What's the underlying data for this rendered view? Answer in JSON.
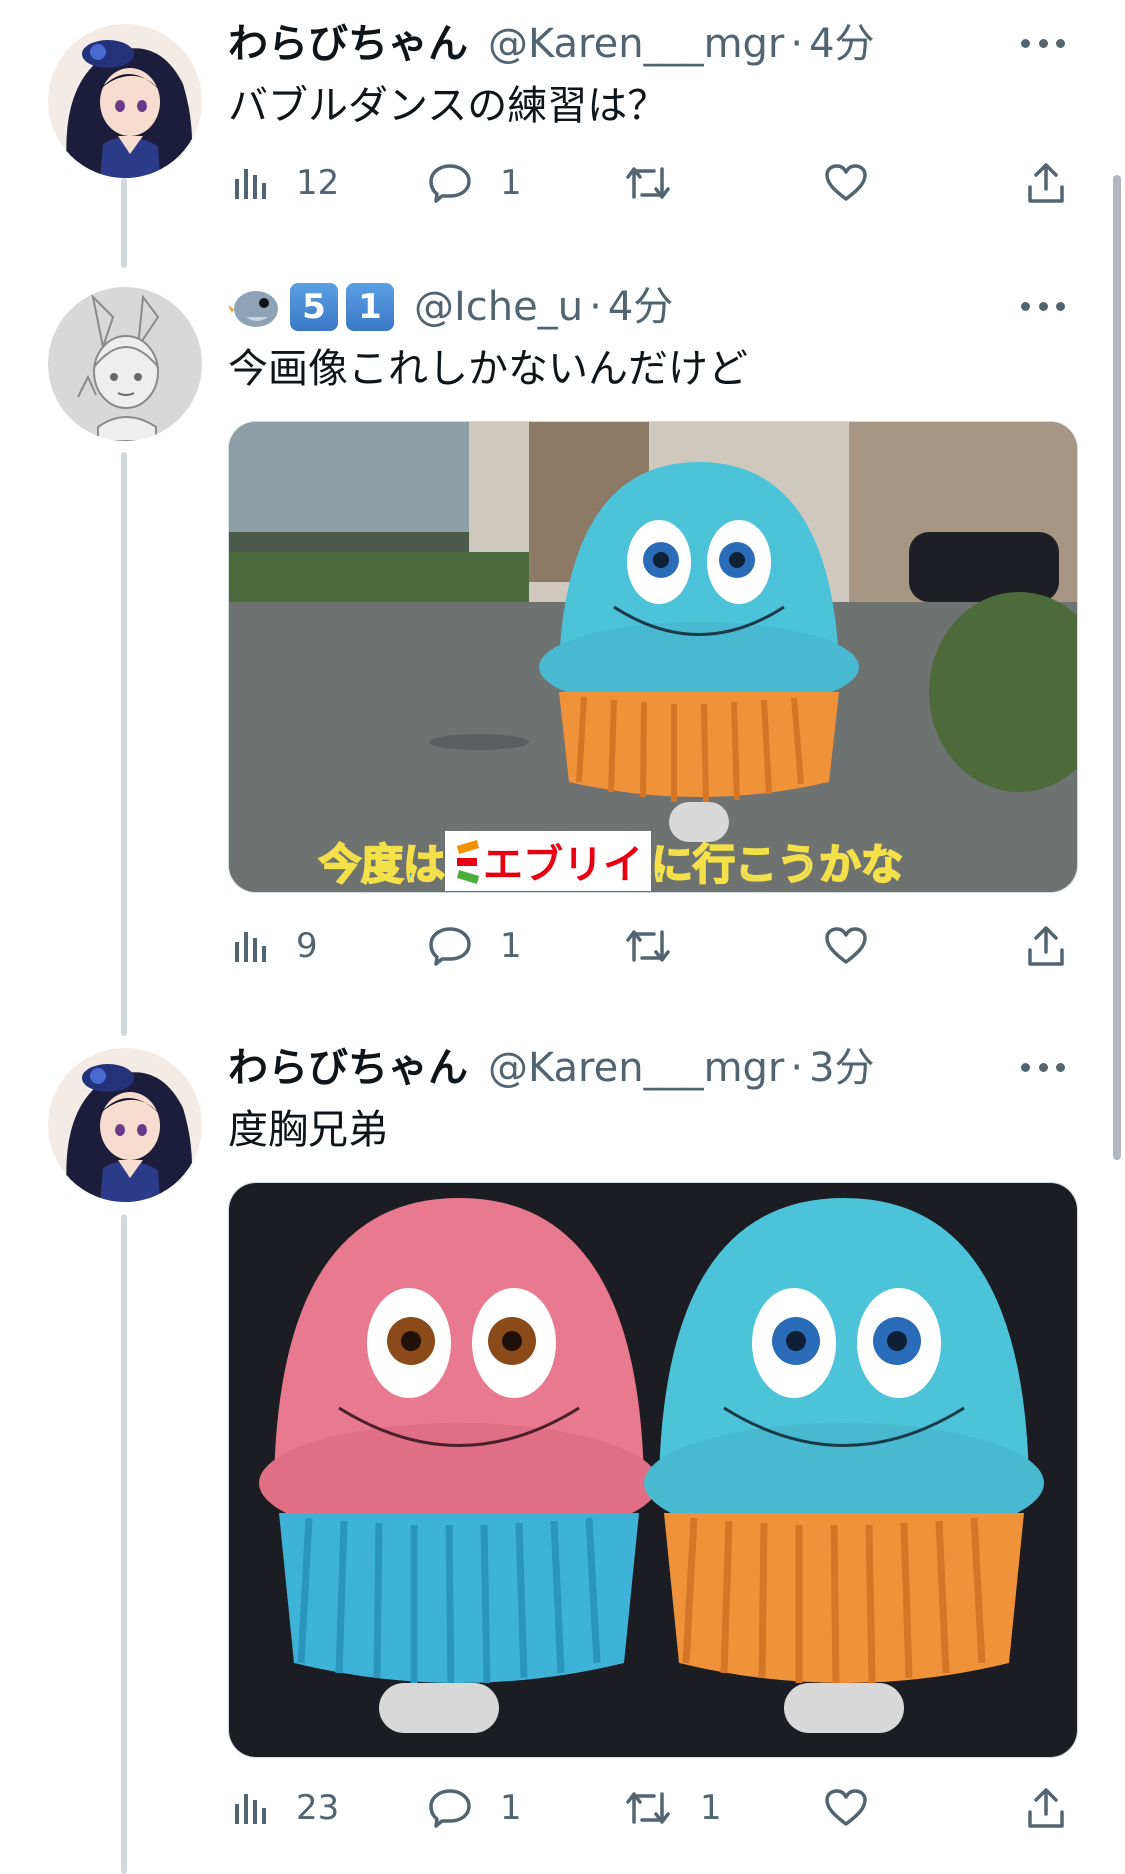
{
  "tweets": [
    {
      "name": "わらびちゃん",
      "handle": "@Karen___mgr",
      "dot": "·",
      "time": "4分",
      "text": "バブルダンスの練習は？",
      "views": "12",
      "replies": "1",
      "retweets": "",
      "likes": ""
    },
    {
      "name": "",
      "badges": [
        "5",
        "1"
      ],
      "handle": "@Iche_u",
      "dot": "·",
      "time": "4分",
      "text": "今画像これしかないんだけど",
      "media_caption_prefix": "今度は",
      "media_caption_logo": "エブリイ",
      "media_caption_suffix": "に行こうかな",
      "views": "9",
      "replies": "1",
      "retweets": "",
      "likes": ""
    },
    {
      "name": "わらびちゃん",
      "handle": "@Karen___mgr",
      "dot": "·",
      "time": "3分",
      "text": "度胸兄弟",
      "views": "23",
      "replies": "1",
      "retweets": "1",
      "likes": ""
    }
  ],
  "icons": {
    "views": "bar-chart-icon",
    "reply": "speech-bubble-icon",
    "retweet": "retweet-icon",
    "like": "heart-icon",
    "share": "share-upload-icon",
    "more": "more-dots-icon"
  },
  "colors": {
    "text_primary": "#0f1419",
    "text_secondary": "#536471",
    "thread_line": "#cfd9de",
    "mascot_blue": "#4cc3d9",
    "mascot_orange": "#f0923a",
    "mascot_pink": "#e8798f"
  }
}
